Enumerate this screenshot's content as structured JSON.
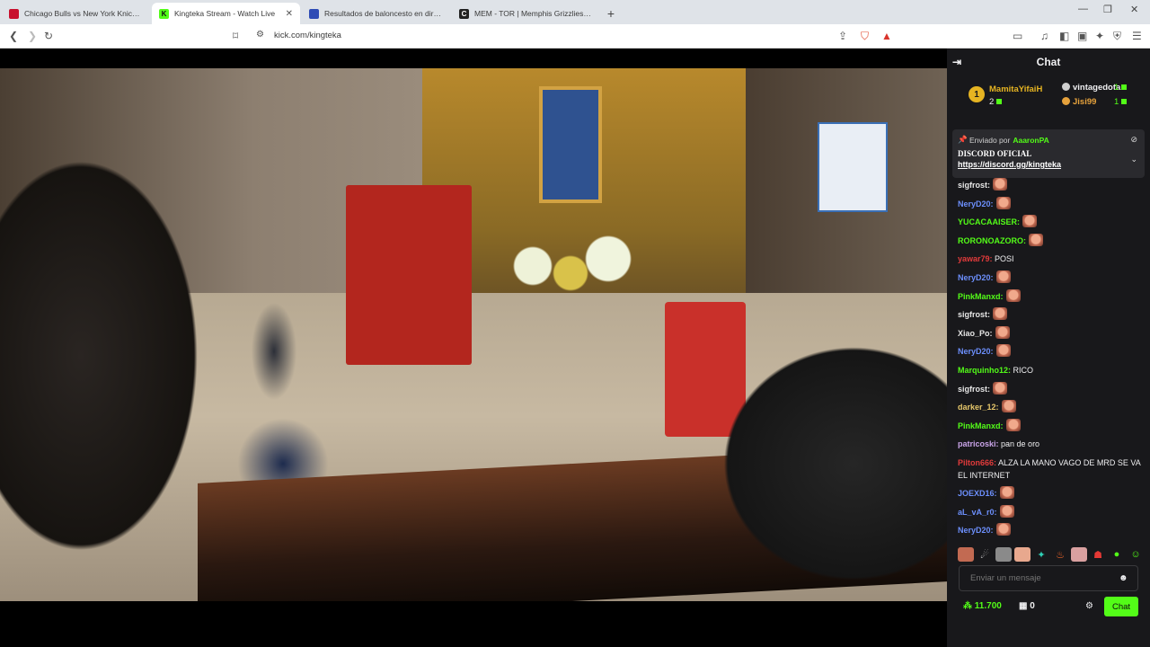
{
  "browser": {
    "tabs": [
      {
        "title": "Chicago Bulls vs New York Knicks Ap",
        "active": false,
        "favicon_color": "#c8102e"
      },
      {
        "title": "Kingteka Stream - Watch Live",
        "active": true,
        "favicon_color": "#53fc18"
      },
      {
        "title": "Resultados de baloncesto en directo",
        "active": false,
        "favicon_color": "#2e4bb5"
      },
      {
        "title": "MEM - TOR | Memphis Grizzlies vs To",
        "active": false,
        "favicon_color": "#222222"
      }
    ],
    "url": "kick.com/kingteka"
  },
  "chat": {
    "header_title": "Chat",
    "leaderboard": {
      "rank": "1",
      "first_name": "MamitaYifaiH",
      "first_count": "2",
      "second_name": "vintagedota",
      "second_count": "1",
      "third_name": "Jisi99",
      "third_count": "1"
    },
    "pinned": {
      "sent_by_label": "Enviado por",
      "sent_by_user": "AaaronPA",
      "title": "DISCORD OFICIAL",
      "link": "https://discord.gg/kingteka"
    },
    "messages": [
      {
        "user": "sigfrost:",
        "color": "#e6e6e6",
        "emote": true,
        "text": ""
      },
      {
        "user": "NeryD20:",
        "color": "#6c8ffc",
        "emote": true,
        "text": ""
      },
      {
        "user": "YUCACAAISER:",
        "color": "#53fc18",
        "emote": true,
        "text": ""
      },
      {
        "user": "RORONOAZORO:",
        "color": "#53fc18",
        "emote": true,
        "text": ""
      },
      {
        "user": "yawar79:",
        "color": "#e23b3b",
        "emote": false,
        "text": "POSI"
      },
      {
        "user": "NeryD20:",
        "color": "#6c8ffc",
        "emote": true,
        "text": ""
      },
      {
        "user": "PinkManxd:",
        "color": "#53fc18",
        "emote": true,
        "text": ""
      },
      {
        "user": "sigfrost:",
        "color": "#e6e6e6",
        "emote": true,
        "text": ""
      },
      {
        "user": "Xiao_Po:",
        "color": "#e6e6e6",
        "emote": true,
        "text": ""
      },
      {
        "user": "NeryD20:",
        "color": "#6c8ffc",
        "emote": true,
        "text": ""
      },
      {
        "user": "Marquinho12:",
        "color": "#53fc18",
        "emote": false,
        "text": "RICO"
      },
      {
        "user": "sigfrost:",
        "color": "#e6e6e6",
        "emote": true,
        "text": ""
      },
      {
        "user": "darker_12:",
        "color": "#e6c76b",
        "emote": true,
        "text": ""
      },
      {
        "user": "PinkManxd:",
        "color": "#53fc18",
        "emote": true,
        "text": ""
      },
      {
        "user": "patricoski:",
        "color": "#c9a4e8",
        "emote": false,
        "text": "pan de oro"
      },
      {
        "user": "Pilton666:",
        "color": "#e23b3b",
        "emote": false,
        "text": "ALZA LA MANO VAGO DE MRD SE VA EL INTERNET"
      },
      {
        "user": "JOEXD16:",
        "color": "#6c8ffc",
        "emote": true,
        "text": ""
      },
      {
        "user": "aL_vA_r0:",
        "color": "#6c8ffc",
        "emote": true,
        "text": ""
      },
      {
        "user": "NeryD20:",
        "color": "#6c8ffc",
        "emote": true,
        "text": ""
      }
    ],
    "input_placeholder": "Enviar un mensaje",
    "points": "11.700",
    "gifts": "0",
    "chat_button": "Chat"
  },
  "colors": {
    "kick_green": "#53fc18",
    "chat_bg": "#18181b",
    "gold": "#e6b422"
  }
}
